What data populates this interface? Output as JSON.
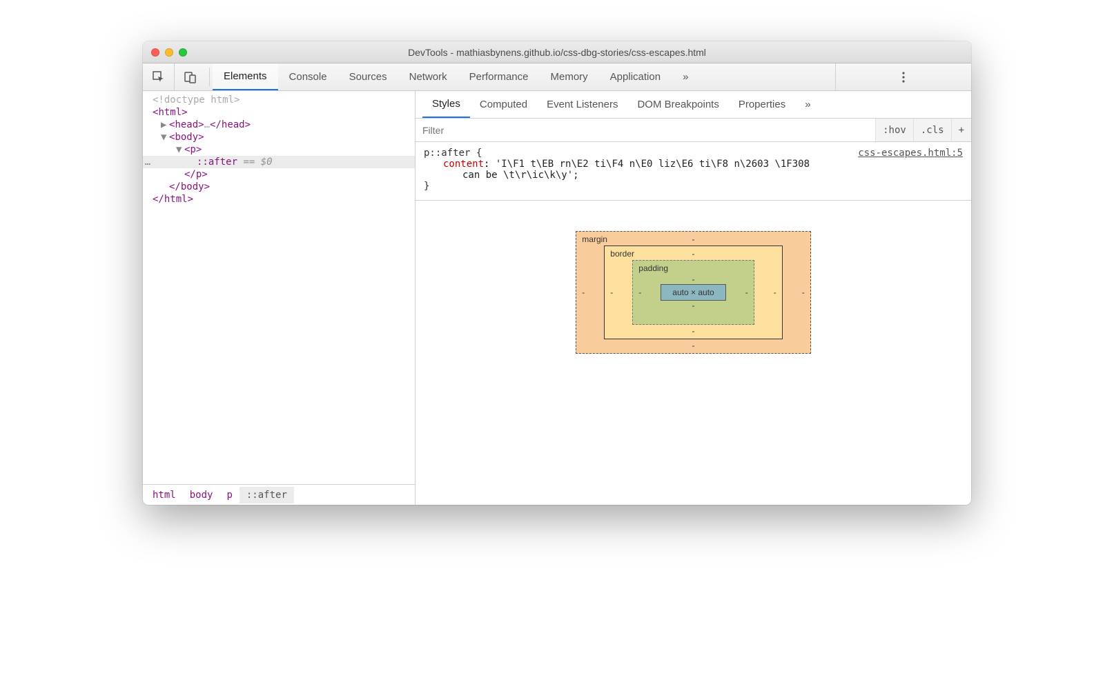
{
  "window": {
    "title": "DevTools - mathiasbynens.github.io/css-dbg-stories/css-escapes.html"
  },
  "mainTabs": {
    "items": [
      "Elements",
      "Console",
      "Sources",
      "Network",
      "Performance",
      "Memory",
      "Application"
    ],
    "more": "»"
  },
  "dom": {
    "doctype": "<!doctype html>",
    "htmlOpen": "html",
    "headOpen": "head",
    "headEllipsis": "…",
    "headClose": "head",
    "bodyOpen": "body",
    "pOpen": "p",
    "pseudo": "::after",
    "eq0": " == $0",
    "pClose": "p",
    "bodyClose": "body",
    "htmlClose": "html",
    "rowDots": "…"
  },
  "breadcrumb": [
    "html",
    "body",
    "p",
    "::after"
  ],
  "subTabs": {
    "items": [
      "Styles",
      "Computed",
      "Event Listeners",
      "DOM Breakpoints",
      "Properties"
    ],
    "more": "»"
  },
  "filter": {
    "placeholder": "Filter",
    "hov": ":hov",
    "cls": ".cls",
    "plus": "+"
  },
  "rule": {
    "source": "css-escapes.html:5",
    "selector": "p::after {",
    "property": "content",
    "valueLine1": "'I\\F1 t\\EB rn\\E2 ti\\F4 n\\E0 liz\\E6 ti\\F8 n\\2603 \\1F308",
    "valueLine2": "can be \\t\\r\\ic\\k\\y';",
    "close": "}"
  },
  "boxModel": {
    "margin": "margin",
    "border": "border",
    "padding": "padding",
    "contentW": "auto",
    "contentH": "auto",
    "dash": "-"
  }
}
